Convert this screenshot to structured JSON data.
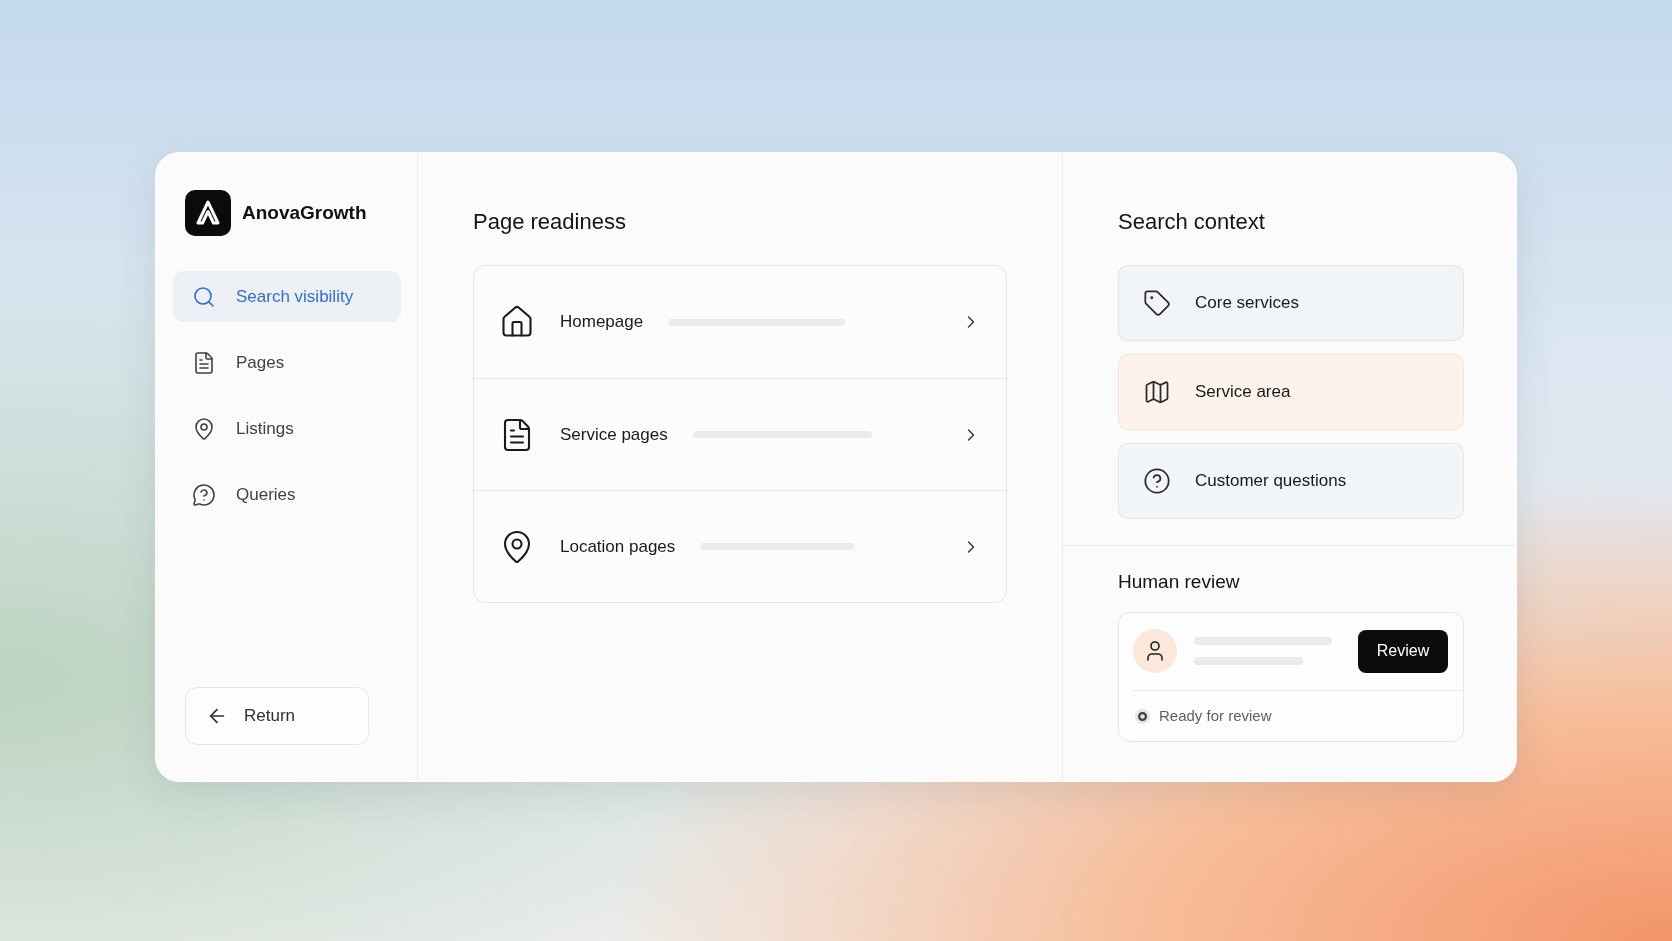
{
  "brand": {
    "name": "AnovaGrowth"
  },
  "sidebar": {
    "items": [
      {
        "label": "Search visibility",
        "selected": true
      },
      {
        "label": "Pages",
        "selected": false
      },
      {
        "label": "Listings",
        "selected": false
      },
      {
        "label": "Queries",
        "selected": false
      }
    ],
    "return_button": {
      "label": "Return"
    }
  },
  "page_readiness": {
    "title": "Page readiness",
    "rows": [
      {
        "label": "Homepage"
      },
      {
        "label": "Service pages"
      },
      {
        "label": "Location pages"
      }
    ]
  },
  "search_context": {
    "title": "Search context",
    "items": [
      {
        "label": "Core services",
        "color": "#f2f5f7"
      },
      {
        "label": "Service area",
        "color": "#fdf3ec"
      },
      {
        "label": "Customer questions",
        "color": "#f2f6f9"
      }
    ]
  },
  "human_review": {
    "title": "Human review",
    "button": "Review",
    "status": "Ready for review"
  }
}
